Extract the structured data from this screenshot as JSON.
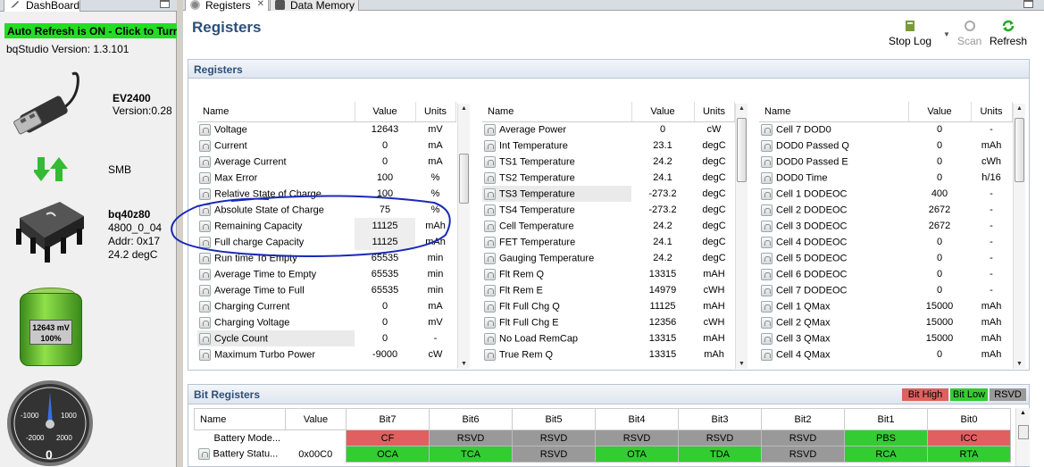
{
  "dashboard": {
    "tab_label": "DashBoard",
    "auto_refresh": "Auto Refresh is ON - Click to Turn",
    "version_label": "bqStudio Version:  1.3.101",
    "adapter_name": "EV2400",
    "adapter_version": "Version:0.28",
    "bus": "SMB",
    "device_name": "bq40z80",
    "device_fw": "4800_0_04",
    "device_addr": "Addr: 0x17",
    "device_temp": "24.2 degC",
    "battery_mv": "12643 mV",
    "battery_pct": "100%",
    "gauge_ticks": [
      "-1000",
      "1000",
      "-2000",
      "2000"
    ],
    "gauge_value": "0",
    "colors": {
      "auto_refresh_bg": "#22dd22"
    }
  },
  "tabs": [
    {
      "label": "Registers",
      "close": "✕"
    },
    {
      "label": "Data Memory"
    }
  ],
  "header": {
    "title": "Registers",
    "buttons": {
      "stop_log": "Stop Log",
      "scan": "Scan",
      "refresh": "Refresh"
    }
  },
  "registers": {
    "section_title": "Registers",
    "columns": [
      "Name",
      "Value",
      "Units"
    ],
    "table1": [
      {
        "name": "Voltage",
        "value": "12643",
        "unit": "mV"
      },
      {
        "name": "Current",
        "value": "0",
        "unit": "mA"
      },
      {
        "name": "Average Current",
        "value": "0",
        "unit": "mA"
      },
      {
        "name": "Max Error",
        "value": "100",
        "unit": "%"
      },
      {
        "name": "Relative State of Charge",
        "value": "100",
        "unit": "%"
      },
      {
        "name": "Absolute State of Charge",
        "value": "75",
        "unit": "%"
      },
      {
        "name": "Remaining Capacity",
        "value": "11125",
        "unit": "mAh"
      },
      {
        "name": "Full charge Capacity",
        "value": "11125",
        "unit": "mAh"
      },
      {
        "name": "Run time To Empty",
        "value": "65535",
        "unit": "min"
      },
      {
        "name": "Average Time to Empty",
        "value": "65535",
        "unit": "min"
      },
      {
        "name": "Average Time to Full",
        "value": "65535",
        "unit": "min"
      },
      {
        "name": "Charging Current",
        "value": "0",
        "unit": "mA"
      },
      {
        "name": "Charging Voltage",
        "value": "0",
        "unit": "mV"
      },
      {
        "name": "Cycle Count",
        "value": "0",
        "unit": "-"
      },
      {
        "name": "Maximum Turbo Power",
        "value": "-9000",
        "unit": "cW"
      }
    ],
    "table2": [
      {
        "name": "Average Power",
        "value": "0",
        "unit": "cW"
      },
      {
        "name": "Int Temperature",
        "value": "23.1",
        "unit": "degC"
      },
      {
        "name": "TS1 Temperature",
        "value": "24.2",
        "unit": "degC"
      },
      {
        "name": "TS2 Temperature",
        "value": "24.1",
        "unit": "degC"
      },
      {
        "name": "TS3 Temperature",
        "value": "-273.2",
        "unit": "degC"
      },
      {
        "name": "TS4 Temperature",
        "value": "-273.2",
        "unit": "degC"
      },
      {
        "name": "Cell Temperature",
        "value": "24.2",
        "unit": "degC"
      },
      {
        "name": "FET Temperature",
        "value": "24.1",
        "unit": "degC"
      },
      {
        "name": "Gauging Temperature",
        "value": "24.2",
        "unit": "degC"
      },
      {
        "name": "Flt Rem Q",
        "value": "13315",
        "unit": "mAH"
      },
      {
        "name": "Flt Rem E",
        "value": "14979",
        "unit": "cWH"
      },
      {
        "name": "Flt Full Chg Q",
        "value": "11125",
        "unit": "mAH"
      },
      {
        "name": "Flt Full Chg E",
        "value": "12356",
        "unit": "cWH"
      },
      {
        "name": "No Load RemCap",
        "value": "13315",
        "unit": "mAH"
      },
      {
        "name": "True Rem Q",
        "value": "13315",
        "unit": "mAh"
      }
    ],
    "table3": [
      {
        "name": "Cell 7 DOD0",
        "value": "0",
        "unit": "-"
      },
      {
        "name": "DOD0 Passed Q",
        "value": "0",
        "unit": "mAh"
      },
      {
        "name": "DOD0 Passed E",
        "value": "0",
        "unit": "cWh"
      },
      {
        "name": "DOD0 Time",
        "value": "0",
        "unit": "h/16"
      },
      {
        "name": "Cell 1 DODEOC",
        "value": "400",
        "unit": "-"
      },
      {
        "name": "Cell 2 DODEOC",
        "value": "2672",
        "unit": "-"
      },
      {
        "name": "Cell 3 DODEOC",
        "value": "2672",
        "unit": "-"
      },
      {
        "name": "Cell 4 DODEOC",
        "value": "0",
        "unit": "-"
      },
      {
        "name": "Cell 5 DODEOC",
        "value": "0",
        "unit": "-"
      },
      {
        "name": "Cell 6 DODEOC",
        "value": "0",
        "unit": "-"
      },
      {
        "name": "Cell 7 DODEOC",
        "value": "0",
        "unit": "-"
      },
      {
        "name": "Cell 1 QMax",
        "value": "15000",
        "unit": "mAh"
      },
      {
        "name": "Cell 2 QMax",
        "value": "15000",
        "unit": "mAh"
      },
      {
        "name": "Cell 3 QMax",
        "value": "15000",
        "unit": "mAh"
      },
      {
        "name": "Cell 4 QMax",
        "value": "0",
        "unit": "mAh"
      }
    ]
  },
  "bit_registers": {
    "section_title": "Bit Registers",
    "legend": {
      "high": "Bit High",
      "low": "Bit Low",
      "rsvd": "RSVD"
    },
    "columns": [
      "Name",
      "Value",
      "Bit7",
      "Bit6",
      "Bit5",
      "Bit4",
      "Bit3",
      "Bit2",
      "Bit1",
      "Bit0"
    ],
    "rows": [
      {
        "name": "Battery Mode...",
        "value": "",
        "bits": [
          "CF",
          "RSVD",
          "RSVD",
          "RSVD",
          "RSVD",
          "RSVD",
          "PBS",
          "ICC"
        ],
        "states": [
          "H",
          "R",
          "R",
          "R",
          "R",
          "R",
          "L",
          "H"
        ]
      },
      {
        "name": "Battery Statu...",
        "value": "0x00C0",
        "bits": [
          "OCA",
          "TCA",
          "RSVD",
          "OTA",
          "TDA",
          "RSVD",
          "RCA",
          "RTA"
        ],
        "states": [
          "L",
          "L",
          "R",
          "L",
          "L",
          "R",
          "L",
          "L"
        ]
      }
    ],
    "colors": {
      "high": "#e06060",
      "low": "#33cc33",
      "rsvd": "#999999"
    }
  }
}
